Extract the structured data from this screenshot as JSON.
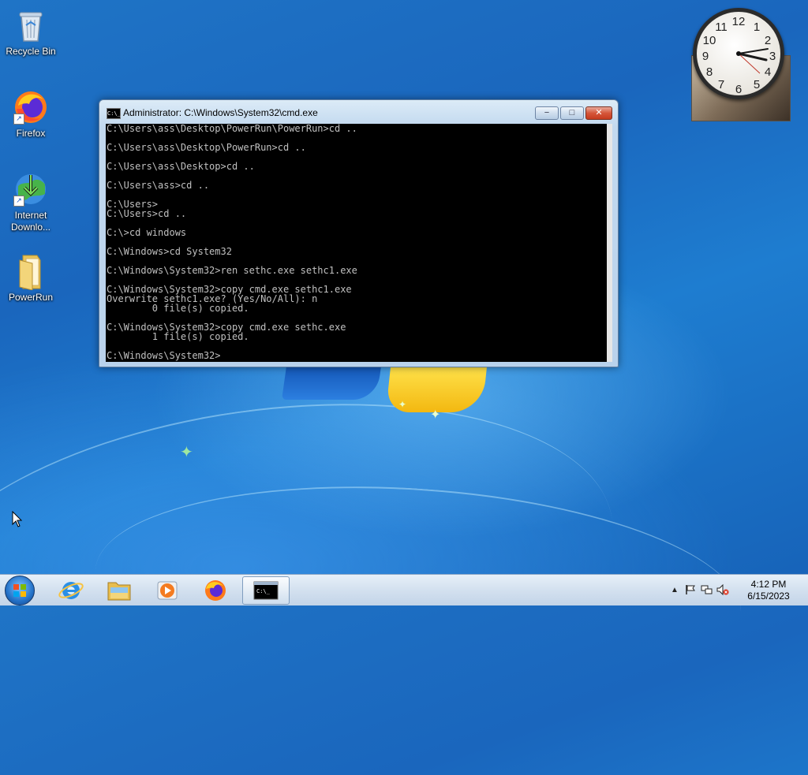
{
  "desktop": {
    "icons": [
      {
        "label": "Recycle Bin"
      },
      {
        "label": "Firefox"
      },
      {
        "label": "Internet Downlo..."
      },
      {
        "label": "PowerRun"
      }
    ]
  },
  "clock_gadget": {
    "numbers": [
      "12",
      "1",
      "2",
      "3",
      "4",
      "5",
      "6",
      "7",
      "8",
      "9",
      "10",
      "11"
    ]
  },
  "cmd_window": {
    "title": "Administrator: C:\\Windows\\System32\\cmd.exe",
    "icon_label": "C:\\_",
    "controls": {
      "minimize": "−",
      "maximize": "□",
      "close": "✕"
    },
    "console_text": "C:\\Users\\ass\\Desktop\\PowerRun\\PowerRun>cd ..\n\nC:\\Users\\ass\\Desktop\\PowerRun>cd ..\n\nC:\\Users\\ass\\Desktop>cd ..\n\nC:\\Users\\ass>cd ..\n\nC:\\Users>\nC:\\Users>cd ..\n\nC:\\>cd windows\n\nC:\\Windows>cd System32\n\nC:\\Windows\\System32>ren sethc.exe sethc1.exe\n\nC:\\Windows\\System32>copy cmd.exe sethc1.exe\nOverwrite sethc1.exe? (Yes/No/All): n\n        0 file(s) copied.\n\nC:\\Windows\\System32>copy cmd.exe sethc.exe\n        1 file(s) copied.\n\nC:\\Windows\\System32>"
  },
  "taskbar": {
    "tray": {
      "time": "4:12 PM",
      "date": "6/15/2023"
    }
  }
}
